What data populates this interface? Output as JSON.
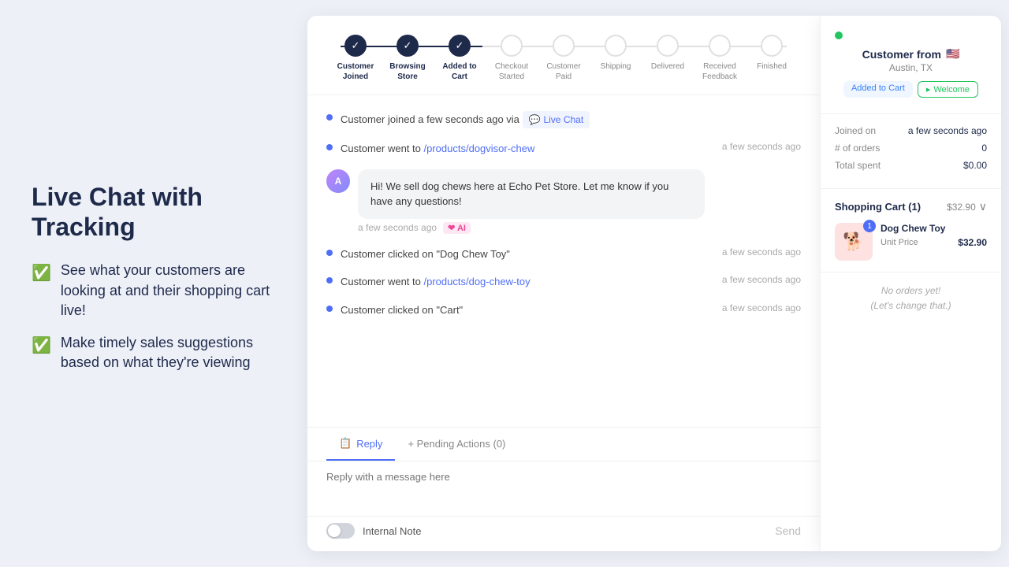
{
  "leftPanel": {
    "title": "Live Chat with Tracking",
    "features": [
      "See what your customers are looking at and their shopping cart live!",
      "Make timely sales suggestions based on what they're viewing"
    ]
  },
  "progressSteps": [
    {
      "label": "Customer\nJoined",
      "state": "completed"
    },
    {
      "label": "Browsing\nStore",
      "state": "completed"
    },
    {
      "label": "Added to\nCart",
      "state": "completed"
    },
    {
      "label": "Checkout\nStarted",
      "state": "inactive"
    },
    {
      "label": "Customer\nPaid",
      "state": "inactive"
    },
    {
      "label": "Shipping",
      "state": "inactive"
    },
    {
      "label": "Delivered",
      "state": "inactive"
    },
    {
      "label": "Received\nFeedback",
      "state": "inactive"
    },
    {
      "label": "Finished",
      "state": "inactive"
    }
  ],
  "activity": [
    {
      "type": "event",
      "text": "Customer joined a few seconds ago via",
      "badge": "Live Chat",
      "time": ""
    },
    {
      "type": "link",
      "text": "Customer went to",
      "link": "/products/dogvisor-chew",
      "time": "a few seconds ago"
    },
    {
      "type": "message",
      "text": "Hi! We sell dog chews here at Echo Pet Store. Let me know if you have any questions!",
      "time": "a few seconds ago",
      "aiBadge": "AI"
    },
    {
      "type": "event",
      "text": "Customer clicked on \"Dog Chew Toy\"",
      "time": "a few seconds ago"
    },
    {
      "type": "link",
      "text": "Customer went to",
      "link": "/products/dog-chew-toy",
      "time": "a few seconds ago"
    },
    {
      "type": "event",
      "text": "Customer clicked on \"Cart\"",
      "time": "a few seconds ago"
    }
  ],
  "tabs": [
    {
      "label": "Reply",
      "icon": "📋",
      "active": true
    },
    {
      "label": "+ Pending Actions (0)",
      "icon": "",
      "active": false
    }
  ],
  "replyPlaceholder": "Reply with a message here",
  "internalNoteLabel": "Internal Note",
  "sendLabel": "Send",
  "sidebar": {
    "customerName": "Customer from",
    "flag": "🇺🇸",
    "location": "Austin, TX",
    "onlineStatus": "online",
    "tags": [
      "Added to Cart",
      "Welcome"
    ],
    "joinedLabel": "Joined on",
    "joinedValue": "a few seconds ago",
    "ordersLabel": "# of orders",
    "ordersValue": "0",
    "totalSpentLabel": "Total spent",
    "totalSpentValue": "$0.00",
    "cartTitle": "Shopping Cart (1)",
    "cartTotal": "$32.90",
    "cartItem": {
      "name": "Dog Chew Toy",
      "unitPriceLabel": "Unit Price",
      "unitPrice": "$32.90",
      "qty": "1",
      "emoji": "🐕"
    },
    "noOrdersText": "No orders yet!\n(Let's change that.)"
  }
}
